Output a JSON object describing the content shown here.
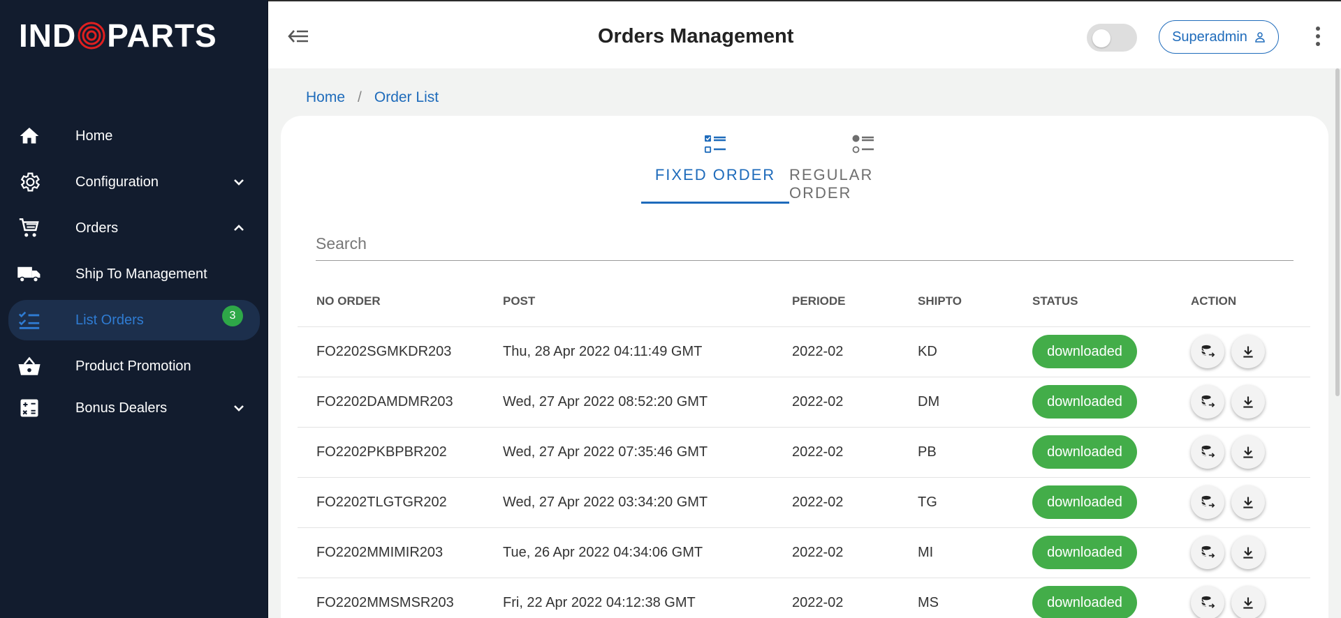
{
  "brand": {
    "logo_left": "IND",
    "logo_right": "PARTS",
    "logo_text": "INDOPARTS",
    "accent": "#e02020"
  },
  "sidebar": {
    "items": [
      {
        "label": "Home",
        "icon": "home-icon"
      },
      {
        "label": "Configuration",
        "icon": "gear-icon",
        "chevron": "down"
      },
      {
        "label": "Orders",
        "icon": "cart-icon",
        "chevron": "up"
      },
      {
        "label": "Ship To Management",
        "icon": "truck-icon"
      },
      {
        "label": "List Orders",
        "icon": "list-check-icon",
        "badge": "3",
        "active": true
      },
      {
        "label": "Product Promotion",
        "icon": "basket-icon"
      },
      {
        "label": "Bonus Dealers",
        "icon": "calculator-icon",
        "chevron": "down"
      }
    ]
  },
  "header": {
    "title": "Orders Management",
    "user_label": "Superadmin",
    "theme_toggle_on": false
  },
  "breadcrumb": {
    "home": "Home",
    "separator": "/",
    "current": "Order List"
  },
  "tabs": [
    {
      "label": "FIXED ORDER",
      "active": true
    },
    {
      "label": "REGULAR ORDER",
      "active": false
    }
  ],
  "search": {
    "placeholder": "Search",
    "value": ""
  },
  "table": {
    "columns": [
      "NO ORDER",
      "POST",
      "PERIODE",
      "SHIPTO",
      "STATUS",
      "ACTION"
    ],
    "rows": [
      {
        "no_order": "FO2202SGMKDR203",
        "post": "Thu, 28 Apr 2022 04:11:49 GMT",
        "periode": "2022-02",
        "shipto": "KD",
        "status": "downloaded"
      },
      {
        "no_order": "FO2202DAMDMR203",
        "post": "Wed, 27 Apr 2022 08:52:20 GMT",
        "periode": "2022-02",
        "shipto": "DM",
        "status": "downloaded"
      },
      {
        "no_order": "FO2202PKBPBR202",
        "post": "Wed, 27 Apr 2022 07:35:46 GMT",
        "periode": "2022-02",
        "shipto": "PB",
        "status": "downloaded"
      },
      {
        "no_order": "FO2202TLGTGR202",
        "post": "Wed, 27 Apr 2022 03:34:20 GMT",
        "periode": "2022-02",
        "shipto": "TG",
        "status": "downloaded"
      },
      {
        "no_order": "FO2202MMIMIR203",
        "post": "Tue, 26 Apr 2022 04:34:06 GMT",
        "periode": "2022-02",
        "shipto": "MI",
        "status": "downloaded"
      },
      {
        "no_order": "FO2202MMSMSR203",
        "post": "Fri, 22 Apr 2022 04:12:38 GMT",
        "periode": "2022-02",
        "shipto": "MS",
        "status": "downloaded"
      }
    ]
  },
  "colors": {
    "sidebar_bg": "#121c2e",
    "active_bg": "#1c2f4c",
    "primary": "#1e6bbb",
    "status_green": "#43ad49",
    "badge_green": "#2ea848"
  }
}
